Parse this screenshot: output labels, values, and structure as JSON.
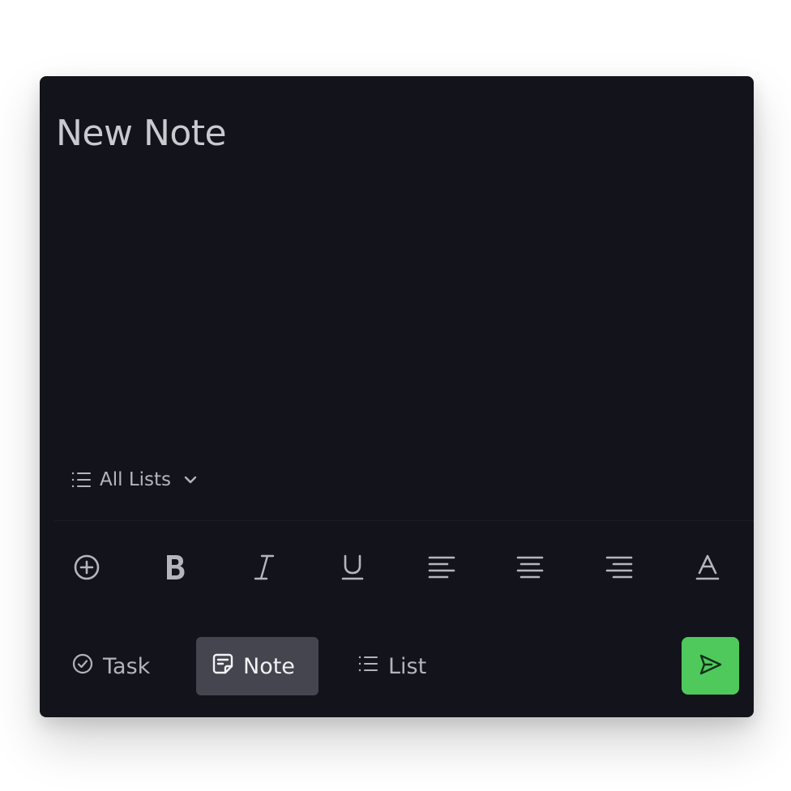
{
  "note": {
    "title_placeholder": "New Note",
    "title_value": ""
  },
  "list_selector": {
    "label": "All Lists",
    "icon": "list-icon",
    "dropdown_icon": "chevron-down-icon"
  },
  "toolbar": {
    "tools": [
      {
        "name": "add",
        "icon": "plus-circle-icon"
      },
      {
        "name": "bold",
        "icon": "bold-icon"
      },
      {
        "name": "italic",
        "icon": "italic-icon"
      },
      {
        "name": "underline",
        "icon": "underline-icon"
      },
      {
        "name": "align-left",
        "icon": "align-left-icon"
      },
      {
        "name": "align-center",
        "icon": "align-center-icon"
      },
      {
        "name": "align-right",
        "icon": "align-right-icon"
      },
      {
        "name": "text-color",
        "icon": "text-color-icon"
      }
    ]
  },
  "modes": {
    "task_label": "Task",
    "note_label": "Note",
    "list_label": "List",
    "selected": "Note"
  },
  "send": {
    "icon": "send-icon"
  },
  "colors": {
    "card_background": "#13131b",
    "selected_mode_background": "#45454f",
    "send_button": "#4fc95c",
    "text_muted": "#b3b3bb"
  }
}
